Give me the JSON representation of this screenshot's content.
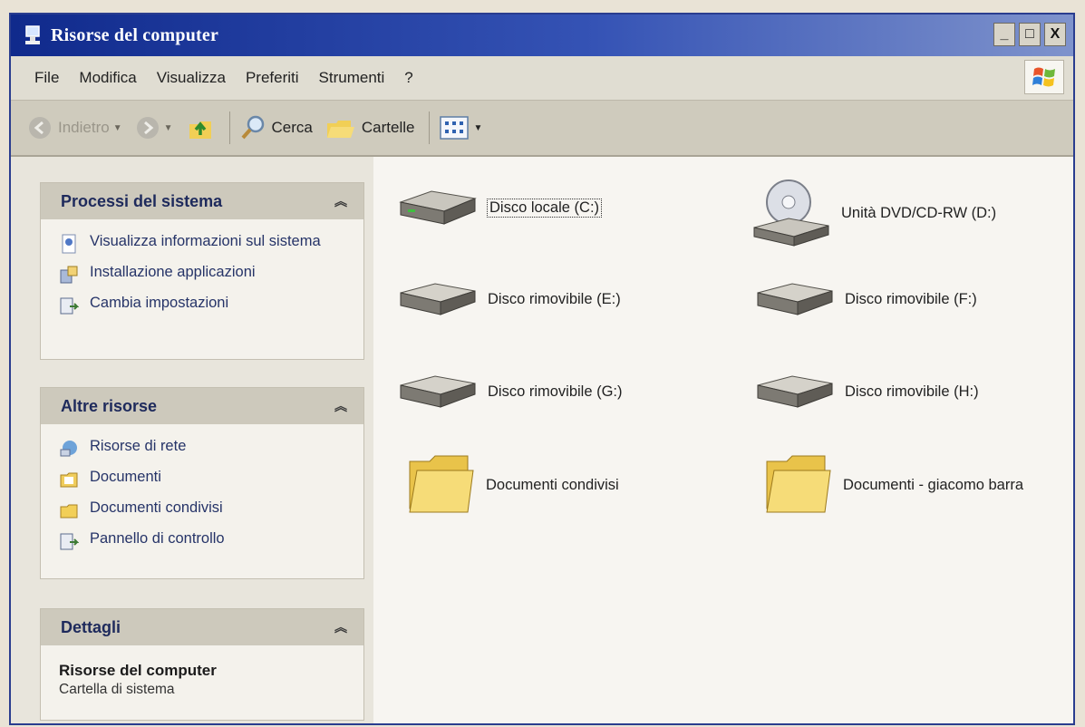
{
  "window": {
    "title": "Risorse del computer",
    "controls": {
      "minimize": "_",
      "maximize": "□",
      "close": "X"
    }
  },
  "menubar": {
    "items": [
      "File",
      "Modifica",
      "Visualizza",
      "Preferiti",
      "Strumenti",
      "?"
    ]
  },
  "toolbar": {
    "back": "Indietro",
    "search": "Cerca",
    "folders": "Cartelle"
  },
  "sidebar": {
    "system_tasks": {
      "title": "Processi del sistema",
      "items": [
        {
          "label": "Visualizza informazioni sul sistema",
          "icon": "system-info-icon"
        },
        {
          "label": "Installazione applicazioni",
          "icon": "add-remove-programs-icon"
        },
        {
          "label": "Cambia impostazioni",
          "icon": "control-panel-icon"
        }
      ]
    },
    "other_places": {
      "title": "Altre risorse",
      "items": [
        {
          "label": "Risorse di rete",
          "icon": "network-icon"
        },
        {
          "label": "Documenti",
          "icon": "documents-icon"
        },
        {
          "label": "Documenti condivisi",
          "icon": "shared-folder-icon"
        },
        {
          "label": "Pannello di controllo",
          "icon": "control-panel-icon"
        }
      ]
    },
    "details": {
      "title": "Dettagli",
      "name": "Risorse del computer",
      "type": "Cartella di sistema"
    }
  },
  "content": {
    "items": [
      {
        "label": "Disco locale (C:)",
        "icon": "hard-drive-icon",
        "selected": true
      },
      {
        "label": "Unità DVD/CD-RW (D:)",
        "icon": "dvd-drive-icon"
      },
      {
        "label": "Disco rimovibile (E:)",
        "icon": "removable-drive-icon"
      },
      {
        "label": "Disco rimovibile (F:)",
        "icon": "removable-drive-icon"
      },
      {
        "label": "Disco rimovibile (G:)",
        "icon": "removable-drive-icon"
      },
      {
        "label": "Disco rimovibile (H:)",
        "icon": "removable-drive-icon"
      },
      {
        "label": "Documenti condivisi",
        "icon": "folder-icon"
      },
      {
        "label": "Documenti - giacomo barra",
        "icon": "folder-icon"
      }
    ]
  },
  "colors": {
    "titlebar": "#1a3593",
    "panel_header": "#cdc9bc",
    "link_text": "#263468"
  }
}
